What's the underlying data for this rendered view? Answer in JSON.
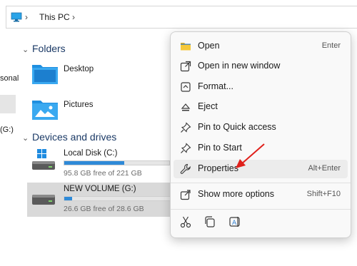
{
  "address_bar": {
    "breadcrumb": "This PC"
  },
  "left_nav": {
    "fragment_1": "sonal",
    "fragment_2": "(G:)"
  },
  "sections": {
    "folders_heading": "Folders",
    "devices_heading": "Devices and drives"
  },
  "folders": [
    {
      "label": "Desktop",
      "icon": "desktop-folder-icon"
    },
    {
      "label": "Pictures",
      "icon": "pictures-folder-icon"
    }
  ],
  "drives": [
    {
      "label": "Local Disk (C:)",
      "free_text": "95.8 GB free of 221 GB",
      "used_fraction": 0.57,
      "icon": "windows-drive-icon"
    },
    {
      "label": "NEW VOLUME (G:)",
      "free_text": "26.6 GB free of 28.6 GB",
      "used_fraction": 0.07,
      "icon": "drive-icon",
      "selected": true
    }
  ],
  "context_menu": {
    "items": [
      {
        "label": "Open",
        "shortcut": "Enter",
        "icon": "folder-open-icon"
      },
      {
        "label": "Open in new window",
        "shortcut": "",
        "icon": "open-new-window-icon"
      },
      {
        "label": "Format...",
        "shortcut": "",
        "icon": "format-icon"
      },
      {
        "label": "Eject",
        "shortcut": "",
        "icon": "eject-icon"
      },
      {
        "label": "Pin to Quick access",
        "shortcut": "",
        "icon": "pin-icon"
      },
      {
        "label": "Pin to Start",
        "shortcut": "",
        "icon": "pin-icon"
      },
      {
        "label": "Properties",
        "shortcut": "Alt+Enter",
        "icon": "wrench-icon",
        "hovered": true
      },
      {
        "label": "Show more options",
        "shortcut": "Shift+F10",
        "icon": "share-icon"
      }
    ],
    "bottom_actions": [
      "cut-icon",
      "copy-icon",
      "rename-icon"
    ]
  },
  "colors": {
    "accent": "#2f8ad8",
    "annotation_arrow": "#e0201b",
    "section_heading": "#1b3a66"
  }
}
